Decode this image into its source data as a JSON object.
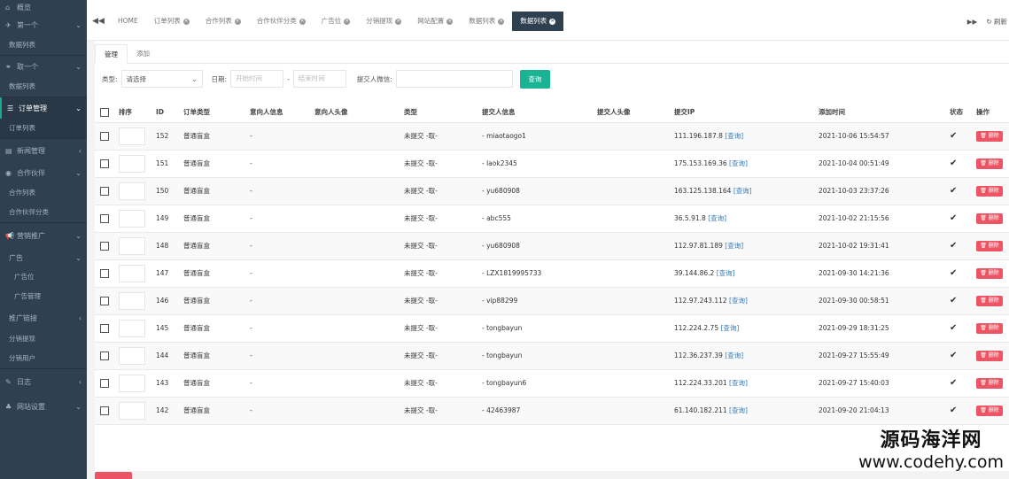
{
  "sidebar": {
    "top_label": "概览",
    "groups": [
      {
        "label": "第一个",
        "children": [
          "数据列表"
        ]
      },
      {
        "label": "取一个",
        "children": [
          "数据列表"
        ]
      },
      {
        "label": "订单管理",
        "children": [
          "订单列表"
        ]
      },
      {
        "label": "新闻管理",
        "children": []
      },
      {
        "label": "合作伙伴",
        "children": [
          "合作列表",
          "合作伙伴分类"
        ]
      },
      {
        "label": "营销推广",
        "children": []
      },
      {
        "label": "广告",
        "children": [
          "广告位",
          "广告管理"
        ]
      },
      {
        "label": "推广链接",
        "children": [
          "分销提现",
          "分销用户"
        ]
      },
      {
        "label": "日志",
        "children": []
      },
      {
        "label": "网站设置",
        "children": []
      }
    ]
  },
  "tabs": [
    {
      "label": "HOME"
    },
    {
      "label": "订单列表"
    },
    {
      "label": "合作列表"
    },
    {
      "label": "合作伙伴分类"
    },
    {
      "label": "广告位"
    },
    {
      "label": "分销提现"
    },
    {
      "label": "网站配置"
    },
    {
      "label": "数据列表"
    },
    {
      "label": "数据列表"
    }
  ],
  "top_right": {
    "refresh_label": "刷新"
  },
  "subtabs": {
    "manage": "管理",
    "add": "添加"
  },
  "filters": {
    "type_label": "类型:",
    "type_value": "请选择",
    "date_label": "日期:",
    "start_placeholder": "开始时间",
    "end_placeholder": "结束时间",
    "wechat_label": "提交人微信:",
    "query_button": "查询"
  },
  "table": {
    "headers": [
      "排序",
      "ID",
      "订单类型",
      "意向人信息",
      "意向人头像",
      "类型",
      "提交人信息",
      "提交人头像",
      "提交IP",
      "添加时间",
      "状态",
      "操作"
    ],
    "query_link": "[查询]",
    "delete_label": "删除",
    "rows": [
      {
        "id": "152",
        "order_type": "普通盲盒",
        "intent_info": "-",
        "type": "未提交 -取-",
        "submitter": "- miaotaogo1",
        "ip": "111.196.187.8",
        "time": "2021-10-06 15:54:57"
      },
      {
        "id": "151",
        "order_type": "普通盲盒",
        "intent_info": "-",
        "type": "未提交 -取-",
        "submitter": "- laok2345",
        "ip": "175.153.169.36",
        "time": "2021-10-04 00:51:49"
      },
      {
        "id": "150",
        "order_type": "普通盲盒",
        "intent_info": "-",
        "type": "未提交 -取-",
        "submitter": "- yu680908",
        "ip": "163.125.138.164",
        "time": "2021-10-03 23:37:26"
      },
      {
        "id": "149",
        "order_type": "普通盲盒",
        "intent_info": "-",
        "type": "未提交 -取-",
        "submitter": "- abc555",
        "ip": "36.5.91.8",
        "time": "2021-10-02 21:15:56"
      },
      {
        "id": "148",
        "order_type": "普通盲盒",
        "intent_info": "-",
        "type": "未提交 -取-",
        "submitter": "- yu680908",
        "ip": "112.97.81.189",
        "time": "2021-10-02 19:31:41"
      },
      {
        "id": "147",
        "order_type": "普通盲盒",
        "intent_info": "-",
        "type": "未提交 -取-",
        "submitter": "- LZX1819995733",
        "ip": "39.144.86.2",
        "time": "2021-09-30 14:21:36"
      },
      {
        "id": "146",
        "order_type": "普通盲盒",
        "intent_info": "-",
        "type": "未提交 -取-",
        "submitter": "- vip88299",
        "ip": "112.97.243.112",
        "time": "2021-09-30 00:58:51"
      },
      {
        "id": "145",
        "order_type": "普通盲盒",
        "intent_info": "-",
        "type": "未提交 -取-",
        "submitter": "- tongbayun",
        "ip": "112.224.2.75",
        "time": "2021-09-29 18:31:25"
      },
      {
        "id": "144",
        "order_type": "普通盲盒",
        "intent_info": "-",
        "type": "未提交 -取-",
        "submitter": "- tongbayun",
        "ip": "112.36.237.39",
        "time": "2021-09-27 15:55:49"
      },
      {
        "id": "143",
        "order_type": "普通盲盒",
        "intent_info": "-",
        "type": "未提交 -取-",
        "submitter": "- tongbayun6",
        "ip": "112.224.33.201",
        "time": "2021-09-27 15:40:03"
      },
      {
        "id": "142",
        "order_type": "普通盲盒",
        "intent_info": "-",
        "type": "未提交 -取-",
        "submitter": "- 42463987",
        "ip": "61.140.182.211",
        "time": "2021-09-20 21:04:13"
      }
    ]
  },
  "watermark": {
    "line1": "源码海洋网",
    "line2": "www.codehy.com"
  }
}
